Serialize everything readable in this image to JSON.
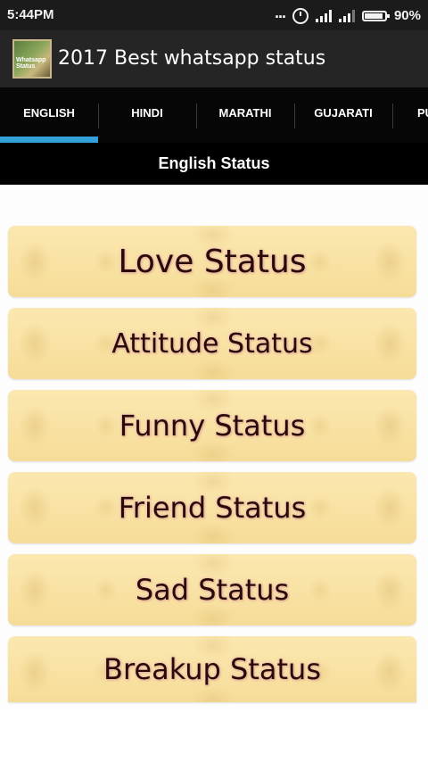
{
  "status_bar": {
    "time": "5:44PM",
    "more": "...",
    "battery": "90%",
    "icons": [
      "alarm-icon",
      "signal-icon",
      "signal-icon",
      "battery-icon"
    ]
  },
  "action_bar": {
    "title": "2017 Best whatsapp status",
    "icon_text": "Whatsapp Status"
  },
  "tabs": [
    {
      "label": "ENGLISH",
      "selected": true
    },
    {
      "label": "HINDI",
      "selected": false
    },
    {
      "label": "MARATHI",
      "selected": false
    },
    {
      "label": "GUJARATI",
      "selected": false
    },
    {
      "label": "PU",
      "selected": false
    }
  ],
  "section_header": "English Status",
  "categories": [
    {
      "label": "Love Status"
    },
    {
      "label": "Attitude Status"
    },
    {
      "label": "Funny Status"
    },
    {
      "label": "Friend Status"
    },
    {
      "label": "Sad Status"
    },
    {
      "label": "Breakup Status"
    }
  ],
  "colors": {
    "tab_indicator": "#33a0d8",
    "card_background": "#f9e3a4",
    "card_text": "#2a0a08"
  }
}
